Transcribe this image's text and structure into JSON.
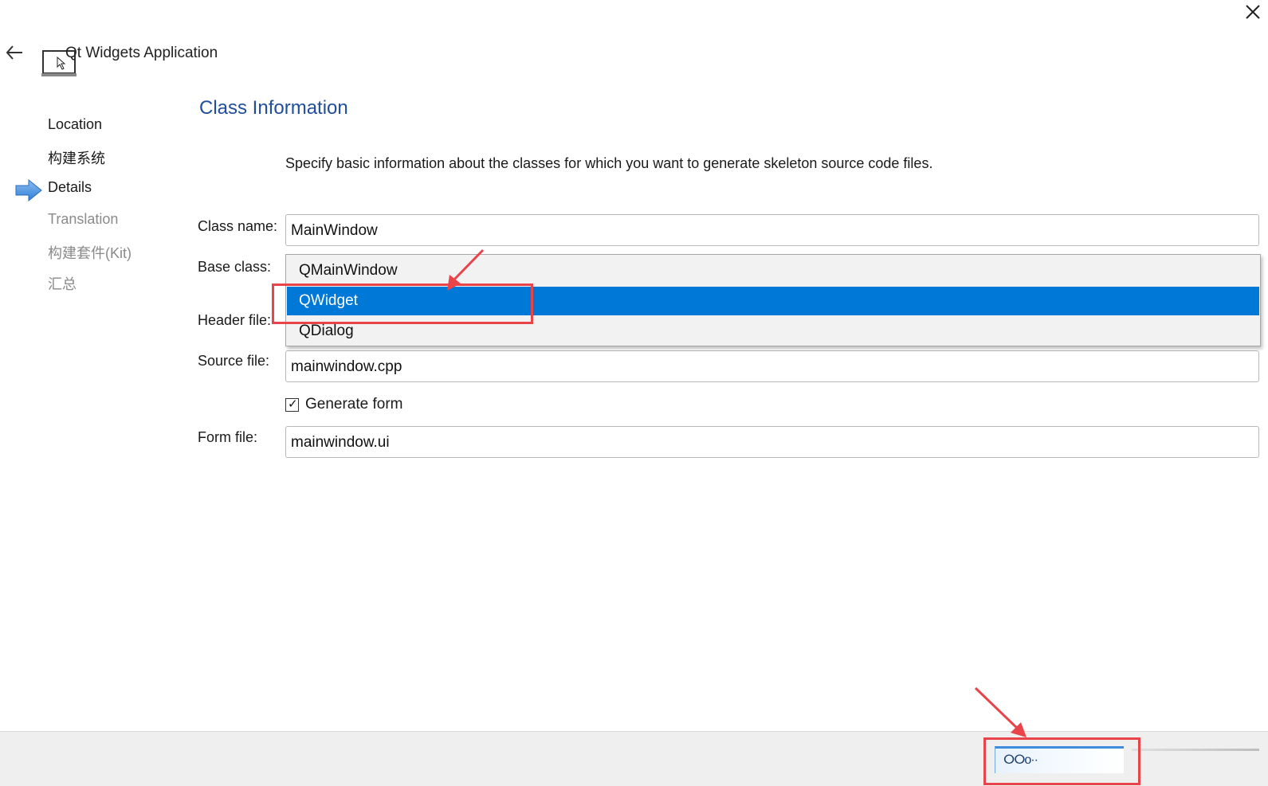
{
  "window": {
    "title": "Qt Widgets Application",
    "icons": {
      "close": "close-icon",
      "back": "back-arrow-icon",
      "app": "qt-widgets-app-icon"
    }
  },
  "steps": [
    {
      "label": "Location",
      "state": "done"
    },
    {
      "label": "构建系统",
      "state": "done"
    },
    {
      "label": "Details",
      "state": "current"
    },
    {
      "label": "Translation",
      "state": "pending"
    },
    {
      "label": "构建套件(Kit)",
      "state": "pending"
    },
    {
      "label": "汇总",
      "state": "pending"
    }
  ],
  "page": {
    "title": "Class Information",
    "description": "Specify basic information about the classes for which you want to generate skeleton source code files."
  },
  "form": {
    "class_name": {
      "label": "Class name:",
      "value": "MainWindow"
    },
    "base_class": {
      "label": "Base class:",
      "options": [
        "QMainWindow",
        "QWidget",
        "QDialog"
      ],
      "highlighted": "QWidget"
    },
    "header_file": {
      "label": "Header file:"
    },
    "source_file": {
      "label": "Source file:",
      "value": "mainwindow.cpp"
    },
    "generate_form": {
      "label": "Generate form",
      "checked": true,
      "mark": "✓"
    },
    "form_file": {
      "label": "Form file:",
      "value": "mainwindow.ui"
    }
  },
  "footer": {
    "next_button_label": "ⵔⵔo··"
  },
  "colors": {
    "accent": "#0078d7",
    "title": "#1f4e9c",
    "annotation": "#e8444a"
  }
}
